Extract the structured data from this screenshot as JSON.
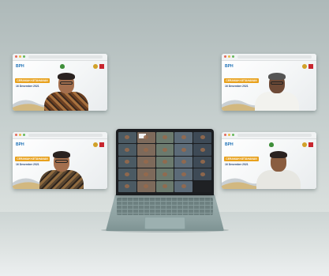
{
  "windows": [
    {
      "id": "top-left",
      "logo": "BPH",
      "banner": "CERAMAH KETAHANAN",
      "date": "16 Desember 2021",
      "body": "batik"
    },
    {
      "id": "top-right",
      "logo": "BPH",
      "banner": "CERAMAH KETAHANAN",
      "date": "16 Desember 2021",
      "body": "white"
    },
    {
      "id": "bottom-left",
      "logo": "BPH",
      "banner": "CERAMAH KETAHANAN",
      "date": "16 Desember 2021",
      "body": "batik2"
    },
    {
      "id": "bottom-right",
      "logo": "BPH",
      "banner": "CERAMAH KETAHANAN",
      "date": "16 Desember 2021",
      "body": "shirt"
    }
  ],
  "laptop": {
    "tile_count": 25,
    "colors": [
      "#4b5a63",
      "#6b7a6e",
      "#3e4a56",
      "#7d6a5b",
      "#5c6b78"
    ]
  }
}
